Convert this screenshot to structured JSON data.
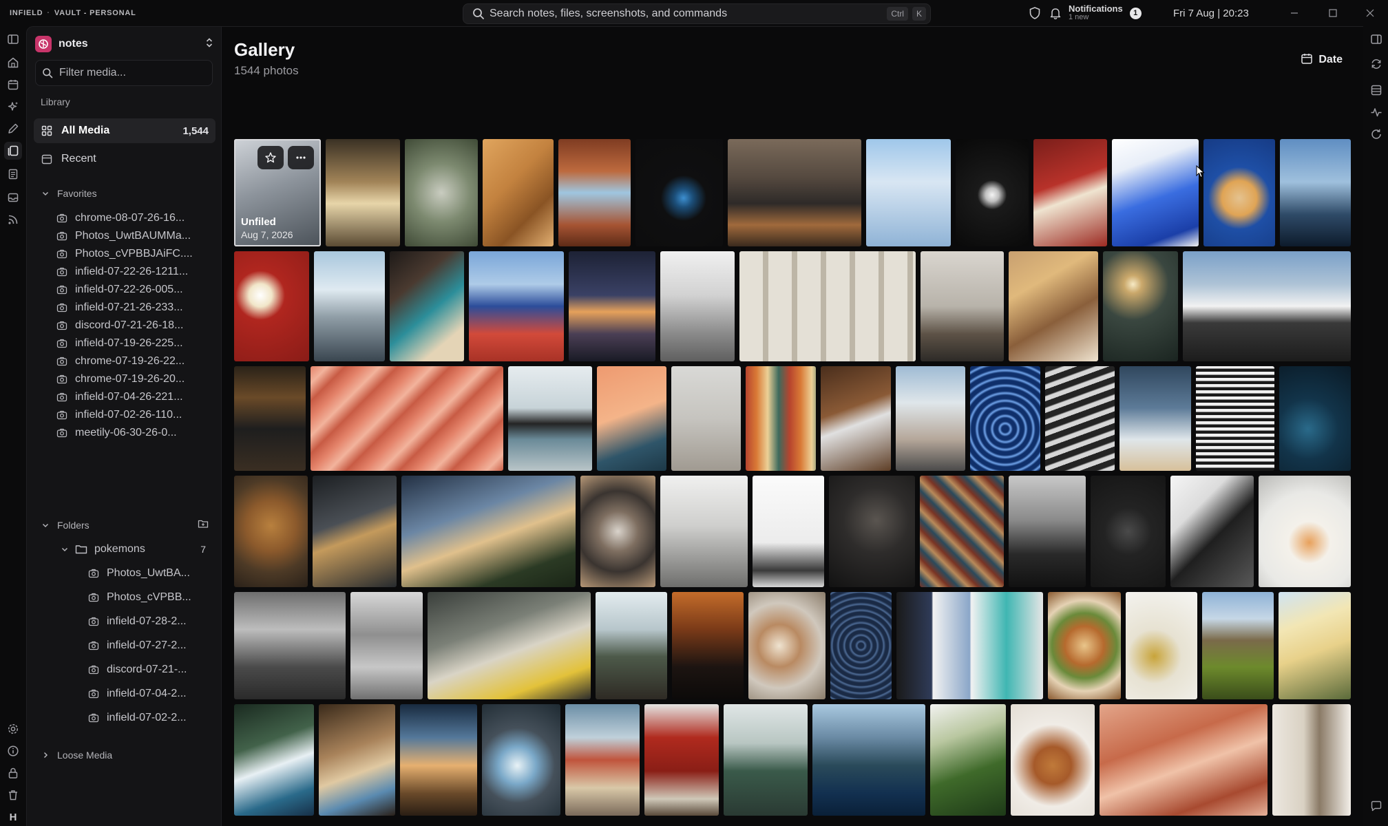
{
  "titlebar": {
    "app_name": "INFIELD",
    "vault_name": "VAULT - PERSONAL",
    "search_placeholder": "Search notes, files, screenshots, and commands",
    "shortcut_ctrl": "Ctrl",
    "shortcut_key": "K",
    "notifications_label": "Notifications",
    "notifications_sub": "1 new",
    "notifications_count": "1",
    "clock": "Fri 7 Aug | 20:23"
  },
  "left_rail": {
    "top_icons": [
      "panel-toggle-icon",
      "home-icon",
      "calendar-icon",
      "sparkle-icon",
      "pen-icon",
      "gallery-icon",
      "document-icon",
      "inbox-icon",
      "rss-icon"
    ],
    "active": "gallery-icon",
    "bottom_icons": [
      "settings-icon",
      "info-icon",
      "lock-icon",
      "trash-icon"
    ],
    "avatar_letter": "H"
  },
  "sidebar": {
    "vault": "notes",
    "filter_placeholder": "Filter media...",
    "library_label": "Library",
    "all_media_label": "All Media",
    "all_media_count": "1,544",
    "recent_label": "Recent",
    "favorites_label": "Favorites",
    "favorites": [
      "chrome-08-07-26-16...",
      "Photos_UwtBAUMMa...",
      "Photos_cVPBBJAiFC....",
      "infield-07-22-26-1211...",
      "infield-07-22-26-005...",
      "infield-07-21-26-233...",
      "discord-07-21-26-18...",
      "infield-07-19-26-225...",
      "chrome-07-19-26-22...",
      "chrome-07-19-26-20...",
      "infield-07-04-26-221...",
      "infield-07-02-26-110...",
      "meetily-06-30-26-0..."
    ],
    "folders_label": "Folders",
    "folder_name": "pokemons",
    "folder_count": "7",
    "folder_items": [
      "Photos_UwtBA...",
      "Photos_cVPBB...",
      "infield-07-28-2...",
      "infield-07-27-2...",
      "discord-07-21-...",
      "infield-07-04-2...",
      "infield-07-02-2..."
    ],
    "loose_media_label": "Loose Media"
  },
  "main": {
    "title": "Gallery",
    "subtitle": "1544 photos",
    "sort_label": "Date",
    "selected_caption_title": "Unfiled",
    "selected_caption_date": "Aug 7, 2026"
  },
  "gallery_rows": [
    {
      "tiles": [
        {
          "w": 125,
          "bg": "linear-gradient(160deg,#cfd3d8 0%,#8d949c 45%,#4b5259 100%)",
          "sel": true
        },
        {
          "w": 107,
          "bg": "linear-gradient(180deg,#3a3124 0%,#a28458 40%,#e7d5a9 60%,#5a4a33 100%)"
        },
        {
          "w": 105,
          "bg": "radial-gradient(circle at 50% 50%,#c9ccc0 0%,#7d8a70 45%,#3f4a36 100%)"
        },
        {
          "w": 102,
          "bg": "linear-gradient(135deg,#e0a55e 0%,#c3823f 40%,#8a5424 70%,#e3b072 100%)"
        },
        {
          "w": 104,
          "bg": "linear-gradient(180deg,#7f3c22 0%,#bd6a3e 30%,#9fc6e0 50%,#a65433 80%,#5d2b17 100%)"
        },
        {
          "w": 126,
          "bg": "radial-gradient(circle at 55% 55%,#3d8fd0 0%,#1c4f7a 12%,#0f0f10 30%,#0c0c0d 100%)"
        },
        {
          "w": 192,
          "bg": "linear-gradient(180deg,#7a6a5a 0%,#564a40 35%,#2e2a28 60%,#a06a3c 80%,#3a2a1e 100%)"
        },
        {
          "w": 122,
          "bg": "linear-gradient(180deg,#9fc7ea 0%,#d8e6f3 40%,#8fb3d6 100%)"
        },
        {
          "w": 105,
          "bg": "radial-gradient(circle at 50% 52%,#f4f4f4 0%,#bfbfbf 10%,#1a1a1a 22%,#080808 100%)"
        },
        {
          "w": 106,
          "bg": "linear-gradient(160deg,#7a1e1a 0%,#b8322a 40%,#efe4d0 55%,#9c2a22 100%)"
        },
        {
          "w": 125,
          "bg": "linear-gradient(160deg,#ffffff 0%,#e8eef8 25%,#3a6de0 55%,#1b3fa8 85%,#f2f2f2 100%)"
        },
        {
          "w": 103,
          "bg": "radial-gradient(circle at 50% 55%,#e4c28f 0%,#e0a455 25%,#1e4fa6 45%,#163b85 100%)"
        },
        {
          "w": 103,
          "bg": "linear-gradient(180deg,#5f8ec2 0%,#9fc0dd 40%,#2f4b68 70%,#0d1b2c 100%)"
        }
      ]
    },
    {
      "tiles": [
        {
          "w": 107,
          "bg": "radial-gradient(circle at 35% 40%,#ffffff 0%,#f1e6c9 14%,#b0261f 30%,#8a1c17 100%)"
        },
        {
          "w": 101,
          "bg": "linear-gradient(180deg,#a9c7dd 0%,#dfeaf1 35%,#8f9da6 60%,#3a4650 100%)"
        },
        {
          "w": 106,
          "bg": "linear-gradient(140deg,#1e1a18 0%,#4a3a30 30%,#2c8e9a 55%,#e4d4b6 80%)"
        },
        {
          "w": 136,
          "bg": "linear-gradient(180deg,#7aa6d8 0%,#aecbe8 30%,#2c4d9a 50%,#d24a3a 75%,#a83226 100%)"
        },
        {
          "w": 124,
          "bg": "linear-gradient(180deg,#1d2235 0%,#3a4165 40%,#e6a15b 55%,#4b3f55 75%,#191a25 100%)"
        },
        {
          "w": 106,
          "bg": "linear-gradient(180deg,#f0f0f0 0%,#d2d2d2 40%,#8a8a8a 75%,#5f5f5f 100%)"
        },
        {
          "w": 252,
          "bg": "repeating-linear-gradient(90deg,#e4e0d6 0px,#e4e0d6 34px,#bdb6a7 34px,#bdb6a7 42px)"
        },
        {
          "w": 119,
          "bg": "linear-gradient(180deg,#d9d5cf 0%,#b8b3aa 50%,#5e5347 75%,#2d2a27 100%)"
        },
        {
          "w": 128,
          "bg": "linear-gradient(150deg,#c8a070 0%,#e0b97c 30%,#8a5f3b 60%,#efe3cf 100%)"
        },
        {
          "w": 107,
          "bg": "radial-gradient(circle at 40% 30%,#f6e9c4 0%,#caa86b 10%,#3a4740 40%,#1a2420 100%)"
        },
        {
          "w": 241,
          "bg": "linear-gradient(180deg,#7aa0c8 0%,#aec3d6 30%,#f2f2f2 50%,#3a3a3a 65%,#1c1c1c 100%)"
        }
      ]
    },
    {
      "tiles": [
        {
          "w": 103,
          "bg": "linear-gradient(180deg,#2a2218 0%,#6a4a28 30%,#1e1e1e 60%,#3a2e22 100%)"
        },
        {
          "w": 277,
          "bg": "repeating-linear-gradient(135deg,#e4836a 0px,#f2b39c 18px,#c85b44 36px,#e4836a 54px)"
        },
        {
          "w": 121,
          "bg": "linear-gradient(180deg,#e6ecef 0%,#c7d3d8 40%,#242424 55%,#6a8a98 70%,#b9c5c8 100%)"
        },
        {
          "w": 100,
          "bg": "linear-gradient(160deg,#ee9a70 0%,#f4b489 45%,#2f5569 75%,#1d3847 100%)"
        },
        {
          "w": 100,
          "bg": "linear-gradient(180deg,#d9d9d6 0%,#c6c4bf 50%,#a09a91 100%)"
        },
        {
          "w": 101,
          "bg": "repeating-linear-gradient(90deg,#b7442e 0px,#d97a36 16px,#ecd096 32px,#3d6a5c 48px,#b7442e 64px)"
        },
        {
          "w": 101,
          "bg": "linear-gradient(160deg,#4a2e1c 0%,#8a5a36 40%,#e0e0e0 55%,#5e3e26 100%)"
        },
        {
          "w": 100,
          "bg": "linear-gradient(180deg,#9fbbd4 0%,#dfe6ea 35%,#b5a79a 70%,#4a4a4a 100%)"
        },
        {
          "w": 101,
          "bg": "repeating-radial-gradient(circle at 50% 60%,#0f2f6a 0px,#0f2f6a 5px,#6fa2e8 8px,#0f2f6a 11px)"
        },
        {
          "w": 100,
          "bg": "repeating-linear-gradient(160deg,#242424 0px,#242424 8px,#d6d6d6 10px,#d6d6d6 16px)"
        },
        {
          "w": 103,
          "bg": "linear-gradient(180deg,#30475e 0%,#5d7b98 40%,#dfe6ea 70%,#d7c09a 100%)"
        },
        {
          "w": 113,
          "bg": "repeating-linear-gradient(0deg,#1a1a1a 0px,#1a1a1a 4px,#f0f0f0 5px,#f0f0f0 9px)"
        },
        {
          "w": 101,
          "bg": "radial-gradient(circle at 40% 60%,#2a6a8a 0%,#12344a 40%,#0a1a26 100%)"
        }
      ]
    },
    {
      "tiles": [
        {
          "w": 106,
          "bg": "radial-gradient(circle at 50% 45%,#b8803e 0%,#8c5a2c 35%,#4d3a26 65%,#2a2119 100%)"
        },
        {
          "w": 121,
          "bg": "linear-gradient(160deg,#1c1f22 0%,#4a4f55 40%,#c49a5c 55%,#262a2e 100%)"
        },
        {
          "w": 251,
          "bg": "linear-gradient(160deg,#233043 0%,#6b86a4 35%,#e0c08c 55%,#2b3a24 80%,#1a2516 100%)"
        },
        {
          "w": 108,
          "bg": "radial-gradient(circle at 50% 50%,#d9d3cb 0%,#7e6e60 30%,#3a3430 60%,#b79877 100%)"
        },
        {
          "w": 126,
          "bg": "linear-gradient(180deg,#f0f0ef 0%,#cfcfcd 45%,#9a9a98 75%,#6e6e6c 100%)"
        },
        {
          "w": 103,
          "bg": "linear-gradient(180deg,#fbfbfb 0%,#ececec 60%,#3a3a3a 85%,#d9d9d9 100%)"
        },
        {
          "w": 124,
          "bg": "radial-gradient(circle at 55% 40%,#5a5550 0%,#2e2c2b 40%,#121212 100%)"
        },
        {
          "w": 121,
          "bg": "repeating-linear-gradient(45deg,#7a3424 0px,#2a4a5c 10px,#b88a5a 20px,#7a3424 30px)"
        },
        {
          "w": 111,
          "bg": "linear-gradient(180deg,#c8c8c8 0%,#8a8a8a 40%,#2a2a2a 70%,#111 100%)"
        },
        {
          "w": 108,
          "bg": "radial-gradient(circle at 50% 50%,#4a4a4a 0%,#232323 35%,#151515 100%)"
        },
        {
          "w": 120,
          "bg": "linear-gradient(135deg,#f5f5f5 0%,#dcdcdc 30%,#1f1f1f 55%,#585858 100%)"
        },
        {
          "w": 132,
          "bg": "radial-gradient(circle at 55% 60%,#e8a15c 0%,#f4f1ea 25%,#e9e9e6 60%,#b9b9b6 100%)"
        }
      ]
    },
    {
      "tiles": [
        {
          "w": 160,
          "bg": "linear-gradient(180deg,#6e6e6e 0%,#bdbdbd 35%,#4a4a4a 70%,#2a2a2a 100%)"
        },
        {
          "w": 104,
          "bg": "linear-gradient(180deg,#d8d8d8 0%,#8f8f8f 40%,#c7c7c7 70%,#707070 100%)"
        },
        {
          "w": 235,
          "bg": "linear-gradient(160deg,#3a3f3b 0%,#7b8077 35%,#d9d4c6 55%,#e3c23a 80%,#2c2c2c 100%)"
        },
        {
          "w": 103,
          "bg": "linear-gradient(180deg,#e3ecef 0%,#b7c6cb 35%,#4d5a4a 60%,#2e2a24 100%)"
        },
        {
          "w": 103,
          "bg": "linear-gradient(180deg,#c46c2a 0%,#7a3a18 35%,#1c1411 70%,#0c0a09 100%)"
        },
        {
          "w": 111,
          "bg": "radial-gradient(circle at 40% 50%,#efe3d0 0%,#b98a62 30%,#d0c8bd 60%,#8a7c6a 100%)"
        },
        {
          "w": 88,
          "bg": "repeating-radial-gradient(circle at 50% 50%,#1a2a45 0px,#1a2a45 4px,#4d6a94 6px,#1a2a45 9px)"
        },
        {
          "w": 211,
          "bg": "linear-gradient(90deg,#1a1a1a 0%,#2f3b58 24%,#f2f2f2 25%,#8aa6c8 50%,#f2f2f2 51%,#3fb6b2 75%,#e5e5e5 100%)"
        },
        {
          "w": 105,
          "bg": "radial-gradient(circle at 50% 50%,#e9c58a 0%,#b66a2e 30%,#6a8a3a 50%,#e5d2b4 70%,#8a5a30 100%)"
        },
        {
          "w": 103,
          "bg": "radial-gradient(circle at 40% 60%,#c8a43a 0%,#e7e2d2 35%,#f5f5f3 100%)"
        },
        {
          "w": 103,
          "bg": "linear-gradient(180deg,#8eb2d6 0%,#c6d7e6 25%,#7a6a4a 45%,#6d8a2c 70%,#3a4d1a 100%)"
        },
        {
          "w": 102,
          "bg": "linear-gradient(160deg,#cfe3f2 0%,#f2e6b4 30%,#e8d18a 55%,#5a6a3a 100%)"
        }
      ]
    },
    {
      "tiles": [
        {
          "w": 115,
          "bg": "linear-gradient(160deg,#1a2a20 0%,#42624a 35%,#e8f0f4 55%,#2a6a8a 80%,#173048 100%)"
        },
        {
          "w": 110,
          "bg": "linear-gradient(160deg,#3a2a1a 0%,#a8825a 40%,#e0c9a2 60%,#5a8ab0 80%,#2a2018 100%)"
        },
        {
          "w": 111,
          "bg": "linear-gradient(180deg,#182a3f 0%,#54789a 30%,#e6b070 55%,#6a4a2a 80%,#2a1e14 100%)"
        },
        {
          "w": 113,
          "bg": "radial-gradient(circle at 45% 55%,#e8f2f6 0%,#7aa8c8 25%,#45505a 50%,#1e2a32 100%)"
        },
        {
          "w": 107,
          "bg": "linear-gradient(180deg,#6b8ea6 0%,#bfd0da 30%,#c0543c 50%,#d9c8a8 75%,#7a6a5a 100%)"
        },
        {
          "w": 107,
          "bg": "linear-gradient(180deg,#e4e4e2 0%,#b02a1e 30%,#8a1e16 60%,#cfc8b8 85%,#5a4a3a 100%)"
        },
        {
          "w": 121,
          "bg": "linear-gradient(180deg,#e0e6e6 0%,#b8c6c2 35%,#3a5a4a 60%,#2a3a33 100%)"
        },
        {
          "w": 163,
          "bg": "linear-gradient(180deg,#a9c9e0 0%,#6a8aa4 30%,#2a4a5a 55%,#123050 80%,#0a2038 100%)"
        },
        {
          "w": 109,
          "bg": "linear-gradient(160deg,#f2f2f0 0%,#b9c7a0 30%,#3f6a2a 60%,#1e3a18 100%)"
        },
        {
          "w": 121,
          "bg": "radial-gradient(circle at 50% 55%,#c07a3a 0%,#a65a2a 25%,#f0ece6 55%,#e3ddd4 100%)"
        },
        {
          "w": 243,
          "bg": "linear-gradient(160deg,#e3a58a 0%,#c76a4a 35%,#f0c2a8 55%,#a84a30 80%,#e6b29a 100%)"
        },
        {
          "w": 117,
          "bg": "linear-gradient(90deg,#ece7df 0%,#d9d1c3 40%,#8a7a66 60%,#f3efe9 100%)"
        }
      ]
    }
  ]
}
